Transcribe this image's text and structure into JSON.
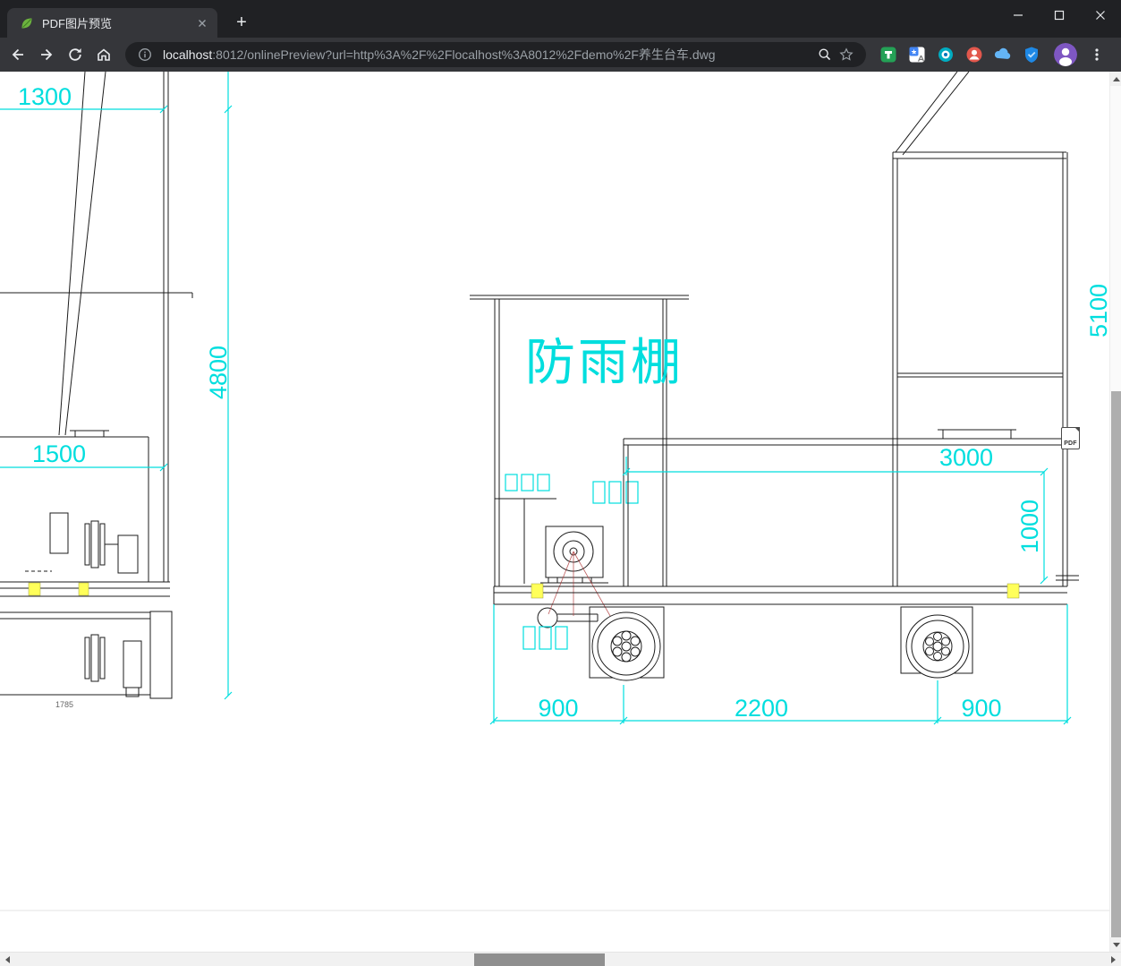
{
  "window": {
    "tab_title": "PDF图片预览",
    "new_tab_label": "+"
  },
  "toolbar": {
    "url_host": "localhost",
    "url_rest": ":8012/onlinePreview?url=http%3A%2F%2Flocalhost%3A8012%2Fdemo%2F养生台车.dwg"
  },
  "drawing": {
    "shelter_label": "防雨棚",
    "dim_1300": "1300",
    "dim_4800": "4800",
    "dim_1500": "1500",
    "dim_5100": "5100",
    "dim_3000": "3000",
    "dim_1000": "1000",
    "dim_900_left": "900",
    "dim_2200": "2200",
    "dim_900_right": "900",
    "dim_1785": "1785"
  },
  "pdf_badge": {
    "label": "PDF"
  },
  "colors": {
    "chrome_dark": "#202124",
    "chrome_toolbar": "#35363a",
    "dimension_cyan": "#00dede",
    "line_black": "#1c1c1c",
    "highlight_yellow": "#ffff5a",
    "accent_red": "#b24040"
  }
}
